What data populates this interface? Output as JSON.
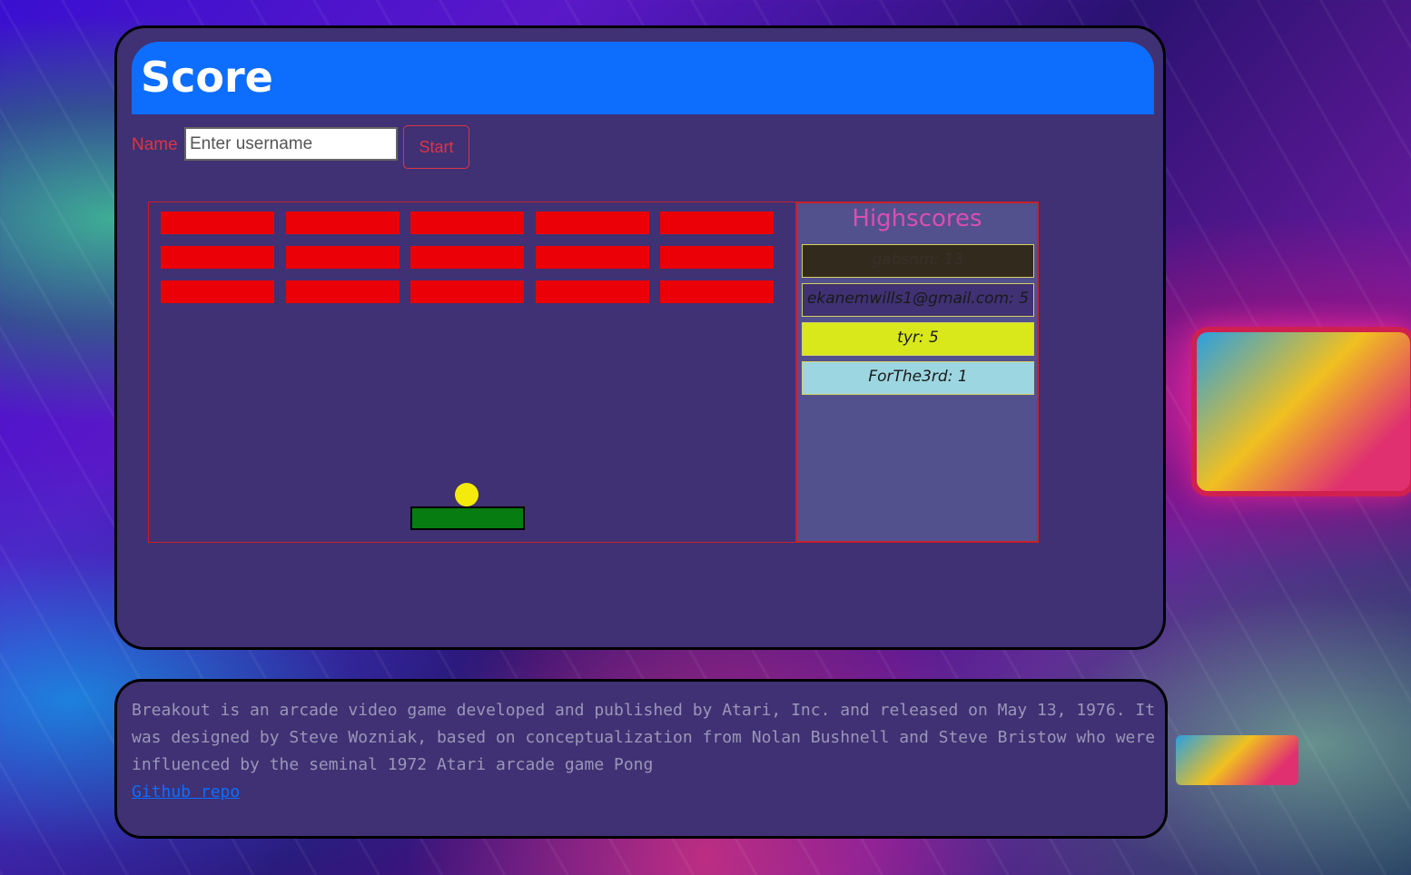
{
  "header": {
    "title": "Score"
  },
  "form": {
    "name_label": "Name",
    "username_placeholder": "Enter username",
    "username_value": "",
    "start_label": "Start"
  },
  "game": {
    "brick_rows": 3,
    "brick_cols": 5,
    "brick_color": "#eb0008",
    "ball_color": "#f4ea0c",
    "paddle_color": "#077d11"
  },
  "highscores": {
    "title": "Highscores",
    "entries": [
      {
        "text": "gabsnm: 13",
        "bg": "#332a1e",
        "color": "#3a2f2a"
      },
      {
        "text": "ekanemwills1@gmail.com: 5",
        "bg": "#3f3173",
        "color": "#1a1a1a"
      },
      {
        "text": "tyr: 5",
        "bg": "#d8e81a",
        "color": "#1a1a1a"
      },
      {
        "text": "ForThe3rd: 1",
        "bg": "#9cd6e0",
        "color": "#1a1a1a"
      }
    ]
  },
  "footer": {
    "description": "Breakout is an arcade video game developed and published by Atari, Inc. and released on May 13, 1976. It was designed by Steve Wozniak, based on conceptualization from Nolan Bushnell and Steve Bristow who were influenced by the seminal 1972 Atari arcade game Pong",
    "link_label": "Github repo"
  }
}
